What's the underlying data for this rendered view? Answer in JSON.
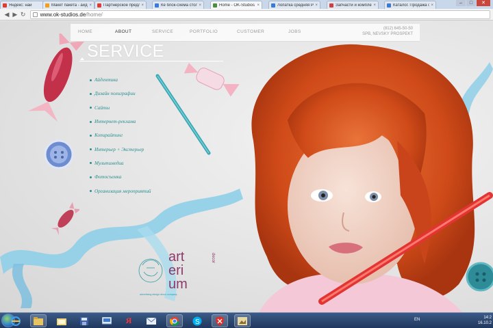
{
  "browser": {
    "tabs": [
      {
        "title": "Яндекс: най",
        "color": "#e03b2f",
        "active": false
      },
      {
        "title": "Макет пакета - айде",
        "color": "#f0a020",
        "active": false
      },
      {
        "title": "Партнерское предл",
        "color": "#e03b2f",
        "active": false
      },
      {
        "title": "Ке блок-схема стол",
        "color": "#3a7bd5",
        "active": false
      },
      {
        "title": "Home - OK-Studios",
        "color": "#4b8f3a",
        "active": true
      },
      {
        "title": "Лопатка средняя Ро",
        "color": "#3a7bd5",
        "active": false
      },
      {
        "title": "Запчасти и компле",
        "color": "#d04040",
        "active": false
      },
      {
        "title": "Каталог. Продажа о",
        "color": "#3a7bd5",
        "active": false
      }
    ],
    "url_host": "www.ok-studios.de",
    "url_path": "/home/",
    "back": "◀",
    "forward": "▶",
    "reload": "↻",
    "minimize": "–",
    "maximize": "□",
    "close": "✕"
  },
  "site": {
    "nav": [
      {
        "label": "HOME",
        "active": false
      },
      {
        "label": "ABOUT",
        "active": true
      },
      {
        "label": "SERVICE",
        "active": false
      },
      {
        "label": "PORTFOLIO",
        "active": false
      },
      {
        "label": "CUSTOMER",
        "active": false
      },
      {
        "label": "JOBS",
        "active": false
      }
    ],
    "phone": "(812) 645-50-50",
    "address": "SPB, NEVSKY PROSPEKT",
    "section_title": "SERVICE",
    "services": [
      "Айдентика",
      "Дизайн полиграфии",
      "Сайты",
      "Интернет-реклама",
      "Копирайтинг",
      "Интерьер + Экстерьер",
      "Мультимедиа",
      "Фотосъемка",
      "Организация мероприятий"
    ],
    "logo": {
      "line1": "art",
      "line2": "eri",
      "line3": "um",
      "side": "decor",
      "tagline": "advertising design decor company"
    }
  },
  "taskbar": {
    "icons": [
      "ie-icon",
      "explorer-icon",
      "folder-icon",
      "save-icon",
      "app-icon",
      "yandex-icon",
      "mail-icon",
      "chrome-icon",
      "skype-icon",
      "kaspersky-icon",
      "photo-icon"
    ],
    "language": "EN",
    "time": "14:2",
    "date": "16.10.2"
  },
  "colors": {
    "service_text": "#2a8d8e",
    "ribbon": "#7ec6e6",
    "hair": "#d9541f",
    "pencil_teal": "#3aa7b3",
    "pencil_red": "#e23432"
  }
}
